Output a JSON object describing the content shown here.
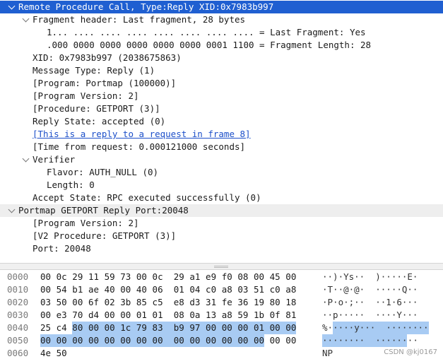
{
  "tree": [
    {
      "id": "rpc",
      "level": 0,
      "expanded": true,
      "style": "selected",
      "text": "Remote Procedure Call, Type:Reply XID:0x7983b997"
    },
    {
      "id": "frag",
      "level": 1,
      "expanded": true,
      "style": "",
      "text": "Fragment header: Last fragment, 28 bytes"
    },
    {
      "id": "lastfrag",
      "level": 2,
      "style": "",
      "text": "1... .... .... .... .... .... .... .... = Last Fragment: Yes"
    },
    {
      "id": "fraglen",
      "level": 2,
      "style": "",
      "text": ".000 0000 0000 0000 0000 0000 0001 1100 = Fragment Length: 28"
    },
    {
      "id": "xid",
      "level": 1,
      "style": "",
      "text": "XID: 0x7983b997 (2038675863)"
    },
    {
      "id": "msgtype",
      "level": 1,
      "style": "",
      "text": "Message Type: Reply (1)"
    },
    {
      "id": "prog",
      "level": 1,
      "style": "",
      "text": "[Program: Portmap (100000)]"
    },
    {
      "id": "progver",
      "level": 1,
      "style": "",
      "text": "[Program Version: 2]"
    },
    {
      "id": "proc",
      "level": 1,
      "style": "",
      "text": "[Procedure: GETPORT (3)]"
    },
    {
      "id": "replystate",
      "level": 1,
      "style": "",
      "text": "Reply State: accepted (0)"
    },
    {
      "id": "replyto",
      "level": 1,
      "style": "link",
      "text": "[This is a reply to a request in frame 8]"
    },
    {
      "id": "timefrom",
      "level": 1,
      "style": "",
      "text": "[Time from request: 0.000121000 seconds]"
    },
    {
      "id": "verifier",
      "level": 1,
      "expanded": true,
      "style": "",
      "text": "Verifier"
    },
    {
      "id": "flavor",
      "level": 2,
      "style": "",
      "text": "Flavor: AUTH_NULL (0)"
    },
    {
      "id": "length",
      "level": 2,
      "style": "",
      "text": "Length: 0"
    },
    {
      "id": "accept",
      "level": 1,
      "style": "",
      "text": "Accept State: RPC executed successfully (0)"
    },
    {
      "id": "portmap",
      "level": 0,
      "expanded": true,
      "style": "section",
      "text": "Portmap GETPORT Reply Port:20048"
    },
    {
      "id": "pm-progver",
      "level": 1,
      "style": "",
      "text": "[Program Version: 2]"
    },
    {
      "id": "pm-proc",
      "level": 1,
      "style": "",
      "text": "[V2 Procedure: GETPORT (3)]"
    },
    {
      "id": "port",
      "level": 1,
      "style": "",
      "text": "Port: 20048"
    }
  ],
  "hexdump": [
    {
      "offset": "0000",
      "bytes": [
        "00",
        "0c",
        "29",
        "11",
        "59",
        "73",
        "00",
        "0c",
        "29",
        "a1",
        "e9",
        "f0",
        "08",
        "00",
        "45",
        "00"
      ],
      "hl": [],
      "ascii": [
        {
          "t": "··)·Ys··  )·····E·",
          "hl": false
        }
      ]
    },
    {
      "offset": "0010",
      "bytes": [
        "00",
        "54",
        "b1",
        "ae",
        "40",
        "00",
        "40",
        "06",
        "01",
        "04",
        "c0",
        "a8",
        "03",
        "51",
        "c0",
        "a8"
      ],
      "hl": [],
      "ascii": [
        {
          "t": "·T··@·@·  ·····Q··",
          "hl": false
        }
      ]
    },
    {
      "offset": "0020",
      "bytes": [
        "03",
        "50",
        "00",
        "6f",
        "02",
        "3b",
        "85",
        "c5",
        "e8",
        "d3",
        "31",
        "fe",
        "36",
        "19",
        "80",
        "18"
      ],
      "hl": [],
      "ascii": [
        {
          "t": "·P·o·;··  ··1·6···",
          "hl": false
        }
      ]
    },
    {
      "offset": "0030",
      "bytes": [
        "00",
        "e3",
        "70",
        "d4",
        "00",
        "00",
        "01",
        "01",
        "08",
        "0a",
        "13",
        "a8",
        "59",
        "1b",
        "0f",
        "81"
      ],
      "hl": [],
      "ascii": [
        {
          "t": "··p·····  ····Y···",
          "hl": false
        }
      ]
    },
    {
      "offset": "0040",
      "bytes": [
        "25",
        "c4",
        "80",
        "00",
        "00",
        "1c",
        "79",
        "83",
        "b9",
        "97",
        "00",
        "00",
        "00",
        "01",
        "00",
        "00"
      ],
      "hl": [
        2,
        3,
        4,
        5,
        6,
        7,
        8,
        9,
        10,
        11,
        12,
        13,
        14,
        15
      ],
      "ascii": [
        {
          "t": "%·",
          "hl": false
        },
        {
          "t": "····y···  ········",
          "hl": true
        }
      ]
    },
    {
      "offset": "0050",
      "bytes": [
        "00",
        "00",
        "00",
        "00",
        "00",
        "00",
        "00",
        "00",
        "00",
        "00",
        "00",
        "00",
        "00",
        "00",
        "00",
        "00"
      ],
      "hl": [
        0,
        1,
        2,
        3,
        4,
        5,
        6,
        7,
        8,
        9,
        10,
        11,
        12,
        13
      ],
      "ascii": [
        {
          "t": "········  ······",
          "hl": true
        },
        {
          "t": "··",
          "hl": false
        }
      ]
    },
    {
      "offset": "0060",
      "bytes": [
        "4e",
        "50"
      ],
      "hl": [],
      "ascii": [
        {
          "t": "NP",
          "hl": false
        }
      ]
    }
  ],
  "watermark": "CSDN @kj0167",
  "colors": {
    "selected": "#1f5fd1",
    "highlight": "#a8cbf3",
    "link": "#1c4fc9"
  }
}
